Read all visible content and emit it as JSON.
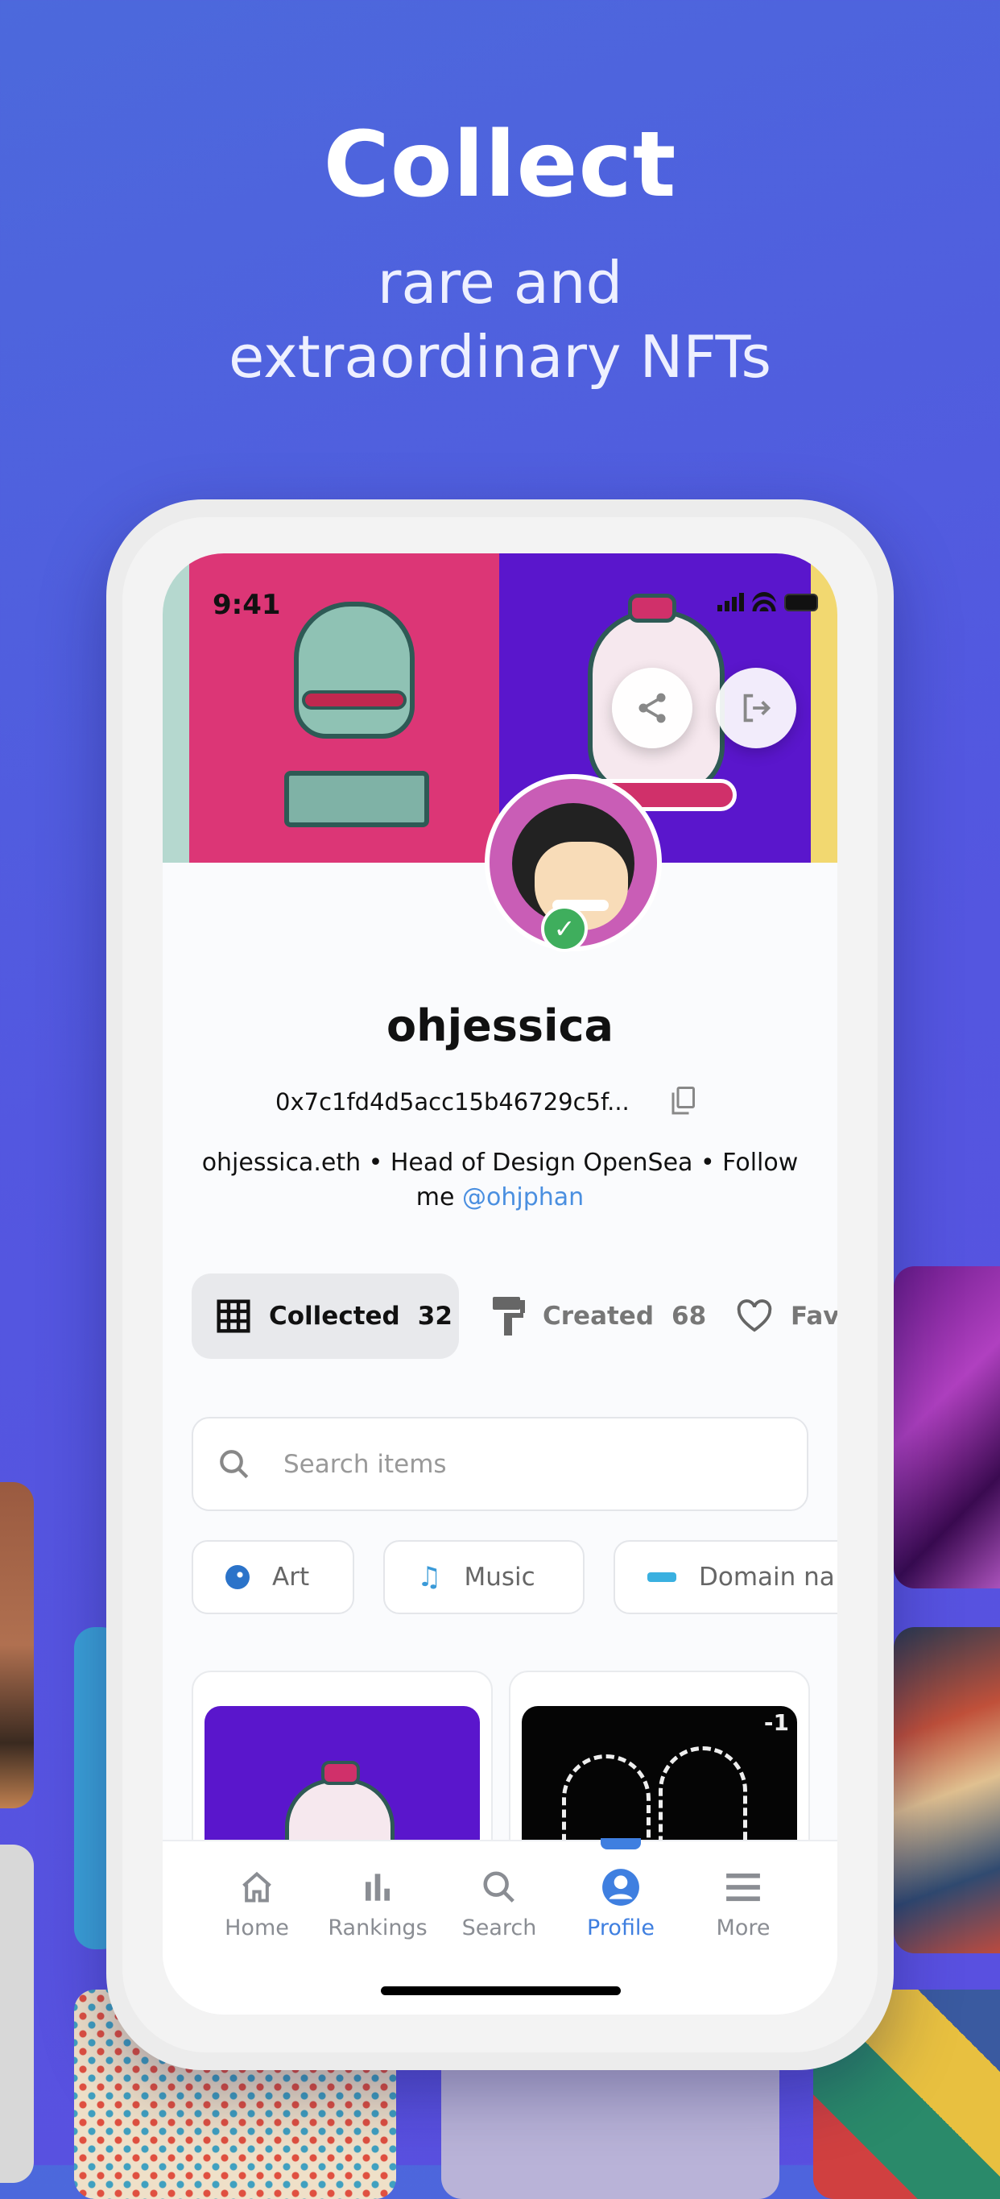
{
  "hero": {
    "title": "Collect",
    "subtitle_line1": "rare and",
    "subtitle_line2": "extraordinary NFTs"
  },
  "status_bar": {
    "time": "9:41"
  },
  "profile": {
    "username": "ohjessica",
    "address": "0x7c1fd4d5acc15b46729c5f...",
    "bio": "ohjessica.eth • Head of Design OpenSea • Follow me",
    "handle": "@ohjphan",
    "verified": true
  },
  "tabs": [
    {
      "label": "Collected",
      "count": "32",
      "icon": "grid-icon",
      "active": true
    },
    {
      "label": "Created",
      "count": "68",
      "icon": "paint-roller-icon"
    },
    {
      "label": "Fav",
      "icon": "heart-icon"
    }
  ],
  "search": {
    "placeholder": "Search items"
  },
  "chips": [
    {
      "label": "Art",
      "icon": "palette-icon"
    },
    {
      "label": "Music",
      "icon": "music-icon"
    },
    {
      "label": "Domain na",
      "icon": "domain-icon"
    }
  ],
  "cards": [
    {
      "art": "pig-nft"
    },
    {
      "art": "cat-chalk-nft",
      "corner_text": "-1"
    }
  ],
  "nav": [
    {
      "label": "Home",
      "icon": "home-icon"
    },
    {
      "label": "Rankings",
      "icon": "bar-chart-icon"
    },
    {
      "label": "Search",
      "icon": "search-icon"
    },
    {
      "label": "Profile",
      "icon": "profile-icon",
      "active": true
    },
    {
      "label": "More",
      "icon": "menu-icon"
    }
  ],
  "colors": {
    "accent": "#3f7fe0",
    "banner_pink": "#dc3676",
    "banner_purple": "#5a16cc",
    "verified": "#3fae5d"
  }
}
